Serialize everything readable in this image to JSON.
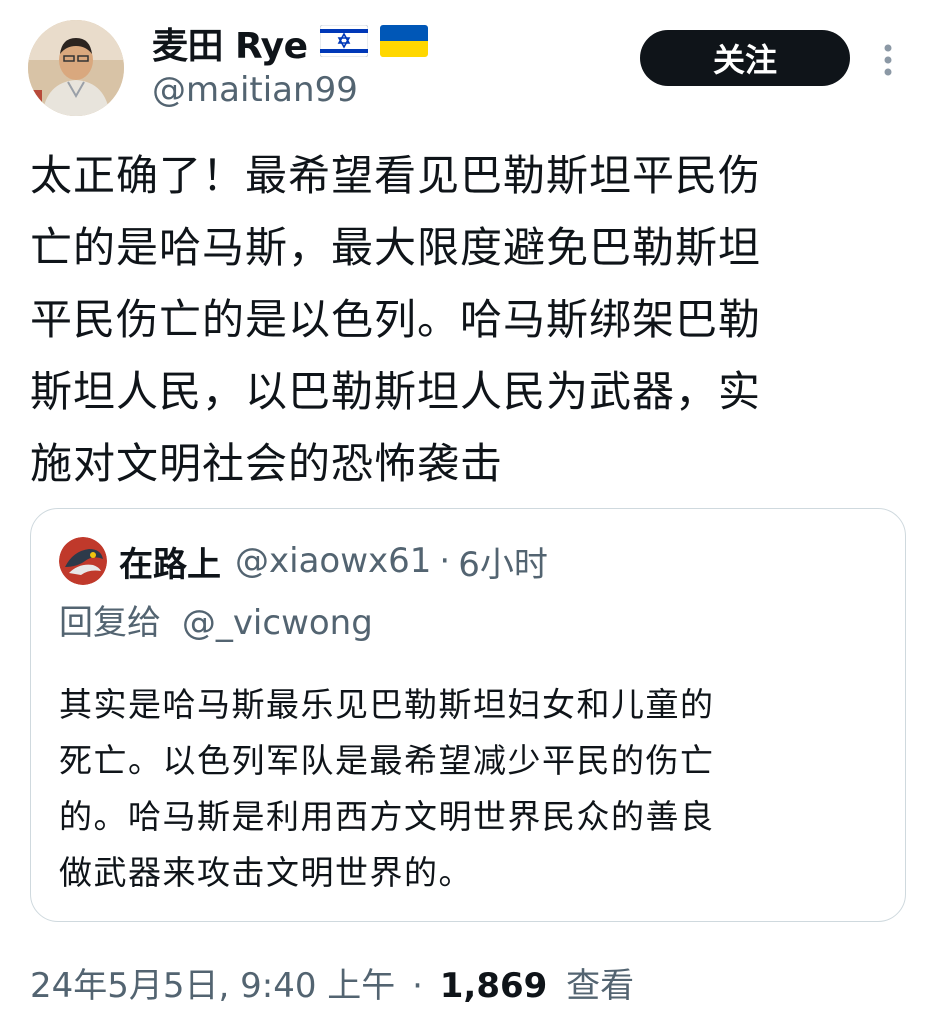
{
  "author": {
    "display_name": "麦田 Rye",
    "flags": [
      "israel-flag-icon",
      "ukraine-flag-icon"
    ],
    "handle": "@maitian99"
  },
  "follow_button": {
    "label": "关注"
  },
  "tweet": {
    "lines": [
      "太正确了！最希望看见巴勒斯坦平民伤",
      "亡的是哈马斯，最大限度避免巴勒斯坦",
      "平民伤亡的是以色列。哈马斯绑架巴勒",
      "斯坦人民，以巴勒斯坦人民为武器，实",
      "施对文明社会的恐怖袭击"
    ]
  },
  "quote": {
    "display_name": "在路上",
    "handle": "@xiaowx61",
    "separator": "·",
    "time": "6小时",
    "reply_to_prefix": "回复给",
    "reply_to_handle": "@_vicwong",
    "lines": [
      "其实是哈马斯最乐见巴勒斯坦妇女和儿童的",
      "死亡。以色列军队是最希望减少平民的伤亡",
      "的。哈马斯是利用西方文明世界民众的善良",
      "做武器来攻击文明世界的。"
    ]
  },
  "footer": {
    "timestamp": "24年5月5日, 9:40 上午",
    "separator": "·",
    "views_count": "1,869",
    "views_label": "查看"
  },
  "colors": {
    "text_primary": "#0f1419",
    "text_secondary": "#536471",
    "border": "#cfd9de",
    "button_bg": "#0f1419"
  }
}
